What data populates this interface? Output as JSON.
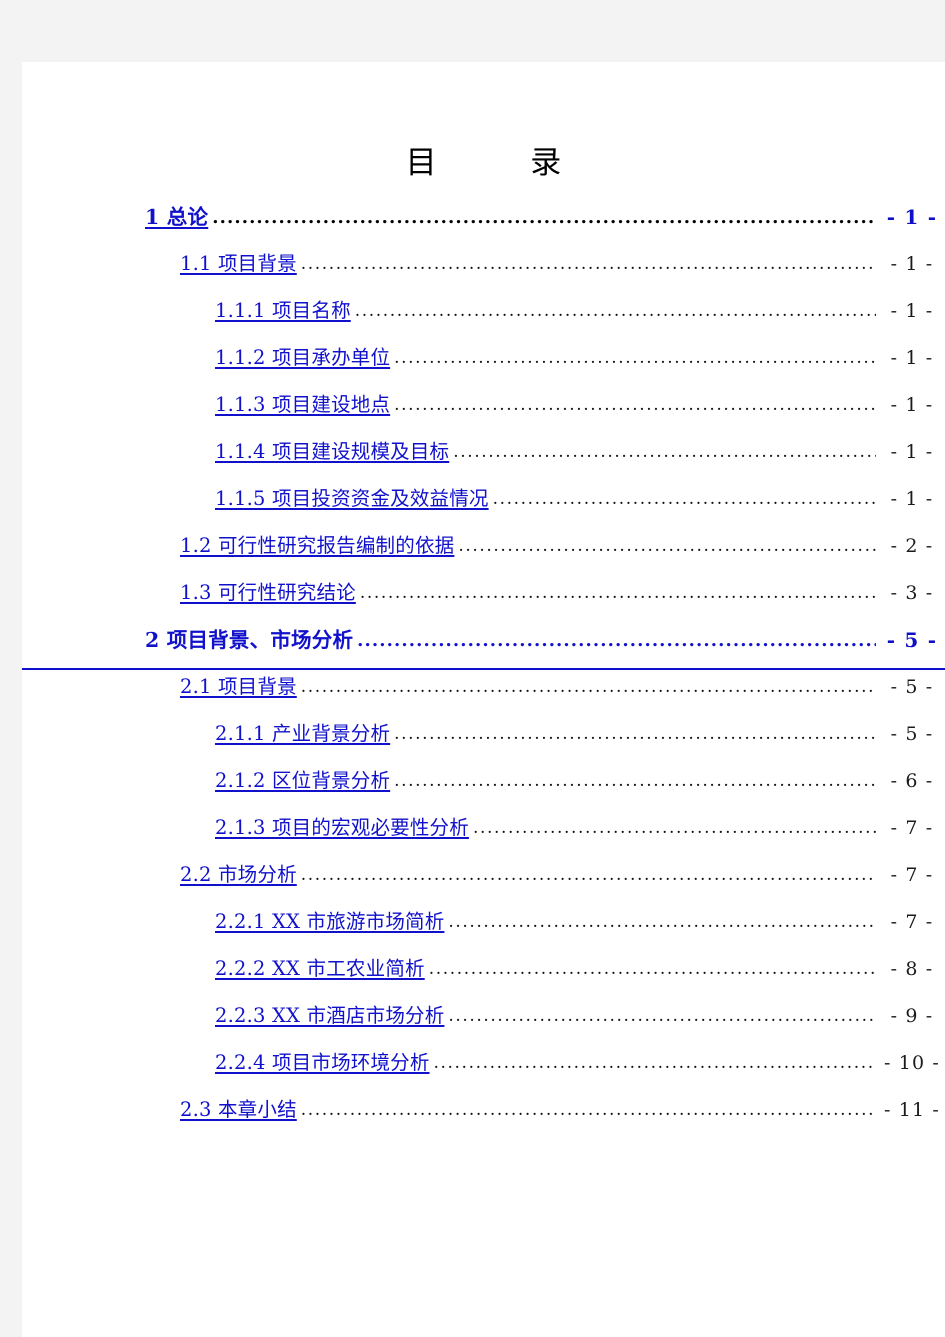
{
  "document": {
    "title": "目　　录",
    "title_plain": "目 录",
    "page_background": "#ffffff",
    "link_color": "#1111cc",
    "text_color": "#000000"
  },
  "toc": {
    "leader_char": ".",
    "page_number_prefix": "-",
    "page_number_suffix": "-",
    "entries": [
      {
        "level": 1,
        "number": "1",
        "label": "1  总论",
        "page": "- 1 -",
        "bold": true,
        "full_rule": false
      },
      {
        "level": 2,
        "number": "1.1",
        "label": "1.1  项目背景",
        "page": "- 1 -",
        "bold": false,
        "full_rule": false
      },
      {
        "level": 3,
        "number": "1.1.1",
        "label": "1.1.1  项目名称",
        "page": "- 1 -",
        "bold": false,
        "full_rule": false
      },
      {
        "level": 3,
        "number": "1.1.2",
        "label": "1.1.2  项目承办单位",
        "page": "- 1 -",
        "bold": false,
        "full_rule": false
      },
      {
        "level": 3,
        "number": "1.1.3",
        "label": "1.1.3  项目建设地点",
        "page": "- 1 -",
        "bold": false,
        "full_rule": false
      },
      {
        "level": 3,
        "number": "1.1.4",
        "label": "1.1.4  项目建设规模及目标",
        "page": "- 1 -",
        "bold": false,
        "full_rule": false
      },
      {
        "level": 3,
        "number": "1.1.5",
        "label": "1.1.5  项目投资资金及效益情况",
        "page": "- 1 -",
        "bold": false,
        "full_rule": false
      },
      {
        "level": 2,
        "number": "1.2",
        "label": "1.2  可行性研究报告编制的依据",
        "page": "- 2 -",
        "bold": false,
        "full_rule": false
      },
      {
        "level": 2,
        "number": "1.3",
        "label": "1.3  可行性研究结论",
        "page": "- 3 -",
        "bold": false,
        "full_rule": false
      },
      {
        "level": 1,
        "number": "2",
        "label": "2  项目背景、市场分析",
        "page": "- 5 -",
        "bold": true,
        "full_rule": true
      },
      {
        "level": 2,
        "number": "2.1",
        "label": "2.1  项目背景",
        "page": "- 5 -",
        "bold": false,
        "full_rule": false
      },
      {
        "level": 3,
        "number": "2.1.1",
        "label": "2.1.1  产业背景分析",
        "page": "- 5 -",
        "bold": false,
        "full_rule": false
      },
      {
        "level": 3,
        "number": "2.1.2",
        "label": "2.1.2  区位背景分析",
        "page": "- 6 -",
        "bold": false,
        "full_rule": false
      },
      {
        "level": 3,
        "number": "2.1.3",
        "label": "2.1.3  项目的宏观必要性分析",
        "page": "- 7 -",
        "bold": false,
        "full_rule": false
      },
      {
        "level": 2,
        "number": "2.2",
        "label": "2.2  市场分析",
        "page": "- 7 -",
        "bold": false,
        "full_rule": false
      },
      {
        "level": 3,
        "number": "2.2.1",
        "label": "2.2.1 XX 市旅游市场简析",
        "page": "- 7 -",
        "bold": false,
        "full_rule": false
      },
      {
        "level": 3,
        "number": "2.2.2",
        "label": "2.2.2 XX 市工农业简析",
        "page": "- 8 -",
        "bold": false,
        "full_rule": false
      },
      {
        "level": 3,
        "number": "2.2.3",
        "label": "2.2.3 XX 市酒店市场分析",
        "page": "- 9 -",
        "bold": false,
        "full_rule": false
      },
      {
        "level": 3,
        "number": "2.2.4",
        "label": "2.2.4  项目市场环境分析",
        "page": "- 10 -",
        "bold": false,
        "full_rule": false
      },
      {
        "level": 2,
        "number": "2.3",
        "label": "2.3  本章小结",
        "page": "- 11 -",
        "bold": false,
        "full_rule": false
      }
    ]
  }
}
